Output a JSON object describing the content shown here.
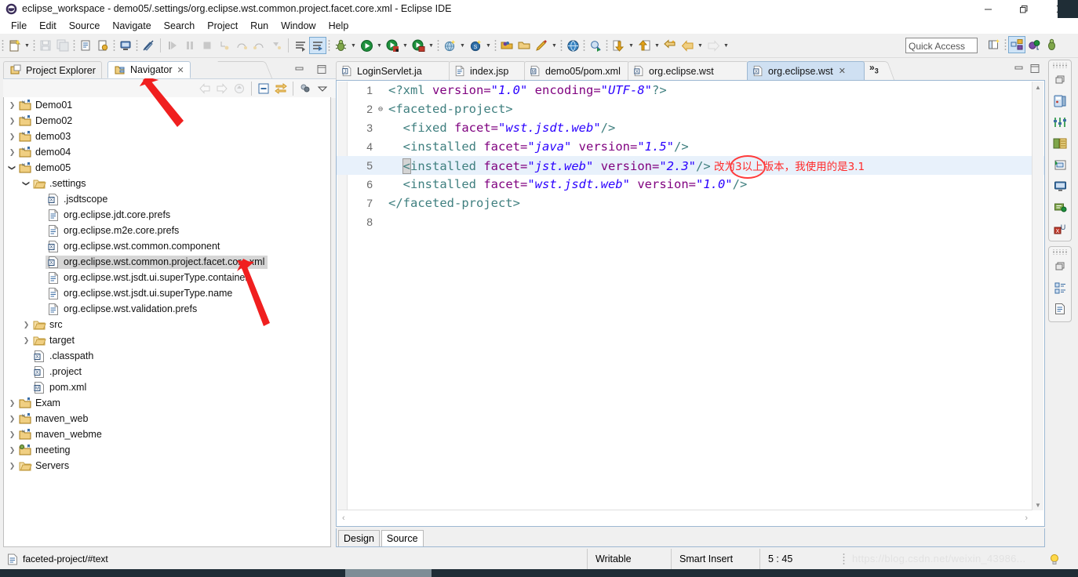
{
  "window": {
    "title": "eclipse_workspace - demo05/.settings/org.eclipse.wst.common.project.facet.core.xml - Eclipse IDE",
    "app_icon": "eclipse-icon",
    "minimize_label": "—",
    "maximize_label": "❐",
    "close_label": "✕"
  },
  "menubar": {
    "items": [
      {
        "label": "File"
      },
      {
        "label": "Edit"
      },
      {
        "label": "Source"
      },
      {
        "label": "Navigate"
      },
      {
        "label": "Search"
      },
      {
        "label": "Project"
      },
      {
        "label": "Run"
      },
      {
        "label": "Window"
      },
      {
        "label": "Help"
      }
    ]
  },
  "toolbar": {
    "quick_access_placeholder": "Quick Access",
    "quick_access_value": "",
    "buttons": [
      {
        "name": "new-wizard-icon",
        "enabled": true,
        "dropdown": true
      },
      {
        "name": "save-icon",
        "enabled": false,
        "dropdown": false
      },
      {
        "name": "save-all-icon",
        "enabled": false,
        "dropdown": false
      },
      {
        "name": "print-icon",
        "enabled": true,
        "dropdown": false
      },
      {
        "name": "export-icon",
        "enabled": true,
        "dropdown": false
      },
      {
        "name": "new-server-icon",
        "enabled": true,
        "dropdown": false
      },
      {
        "name": "no-marker-icon",
        "enabled": true,
        "dropdown": false
      },
      {
        "name": "resume-icon",
        "enabled": false,
        "dropdown": false
      },
      {
        "name": "suspend-icon",
        "enabled": false,
        "dropdown": false
      },
      {
        "name": "terminate-icon",
        "enabled": false,
        "dropdown": false
      },
      {
        "name": "step-into-icon",
        "enabled": false,
        "dropdown": false
      },
      {
        "name": "step-over-icon",
        "enabled": false,
        "dropdown": false
      },
      {
        "name": "step-return-icon",
        "enabled": false,
        "dropdown": false
      },
      {
        "name": "drop-to-frame-icon",
        "enabled": false,
        "dropdown": false
      },
      {
        "name": "skip-breakpoints-icon",
        "enabled": true,
        "dropdown": false
      },
      {
        "name": "toggle-breakpoint-icon",
        "enabled": true,
        "dropdown": false,
        "selected": true
      },
      {
        "name": "debug-icon",
        "enabled": true,
        "dropdown": true
      },
      {
        "name": "run-icon",
        "enabled": true,
        "dropdown": true
      },
      {
        "name": "run-server-icon",
        "enabled": true,
        "dropdown": true
      },
      {
        "name": "stop-server-icon",
        "enabled": true,
        "dropdown": true
      },
      {
        "name": "new-web-project-icon",
        "enabled": true,
        "dropdown": true
      },
      {
        "name": "new-ejb-icon",
        "enabled": true,
        "dropdown": true
      },
      {
        "name": "open-type-icon",
        "enabled": true,
        "dropdown": false
      },
      {
        "name": "open-resource-icon",
        "enabled": true,
        "dropdown": false
      },
      {
        "name": "maven-build-icon",
        "enabled": true,
        "dropdown": true
      },
      {
        "name": "web-browser-icon",
        "enabled": true,
        "dropdown": false
      },
      {
        "name": "search-icon",
        "enabled": true,
        "dropdown": false
      },
      {
        "name": "next-annotation-icon",
        "enabled": true,
        "dropdown": true
      },
      {
        "name": "previous-annotation-icon",
        "enabled": true,
        "dropdown": true
      },
      {
        "name": "last-edit-location-icon",
        "enabled": true,
        "dropdown": false
      },
      {
        "name": "back-icon",
        "enabled": true,
        "dropdown": true
      },
      {
        "name": "forward-icon",
        "enabled": false,
        "dropdown": true
      }
    ],
    "perspective_buttons": [
      {
        "name": "open-perspective-icon",
        "selected": false
      },
      {
        "name": "perspective-java-ee-icon",
        "selected": true
      },
      {
        "name": "perspective-java-icon",
        "selected": false
      },
      {
        "name": "perspective-debug-icon",
        "selected": false
      }
    ]
  },
  "left_view": {
    "tabs": [
      {
        "label": "Project Explorer",
        "icon": "project-explorer-icon",
        "active": false,
        "closable": false
      },
      {
        "label": "Navigator",
        "icon": "navigator-icon",
        "active": true,
        "closable": true
      }
    ],
    "close_glyph": "✕",
    "minimize_glyph": "—",
    "maximize_glyph": "❐",
    "view_toolbar": [
      {
        "name": "back-icon",
        "enabled": false
      },
      {
        "name": "forward-icon",
        "enabled": false
      },
      {
        "name": "up-one-level-icon",
        "enabled": false
      },
      {
        "name": "collapse-all-icon",
        "enabled": true
      },
      {
        "name": "link-with-editor-icon",
        "enabled": true
      },
      {
        "name": "filters-icon",
        "enabled": true
      },
      {
        "name": "view-menu-icon",
        "enabled": true
      }
    ],
    "tree": [
      {
        "label": "Demo01",
        "depth": 0,
        "icon": "maven-project-icon",
        "state": "collapsed",
        "selected": false
      },
      {
        "label": "Demo02",
        "depth": 0,
        "icon": "maven-project-icon",
        "state": "collapsed",
        "selected": false
      },
      {
        "label": "demo03",
        "depth": 0,
        "icon": "maven-project-icon",
        "state": "collapsed",
        "selected": false
      },
      {
        "label": "demo04",
        "depth": 0,
        "icon": "maven-project-icon",
        "state": "collapsed",
        "selected": false
      },
      {
        "label": "demo05",
        "depth": 0,
        "icon": "maven-project-icon",
        "state": "expanded",
        "selected": false
      },
      {
        "label": ".settings",
        "depth": 1,
        "icon": "folder-icon",
        "state": "expanded",
        "selected": false
      },
      {
        "label": ".jsdtscope",
        "depth": 2,
        "icon": "xml-file-icon",
        "state": "leaf",
        "selected": false
      },
      {
        "label": "org.eclipse.jdt.core.prefs",
        "depth": 2,
        "icon": "text-file-icon",
        "state": "leaf",
        "selected": false
      },
      {
        "label": "org.eclipse.m2e.core.prefs",
        "depth": 2,
        "icon": "text-file-icon",
        "state": "leaf",
        "selected": false
      },
      {
        "label": "org.eclipse.wst.common.component",
        "depth": 2,
        "icon": "xml-file-icon",
        "state": "leaf",
        "selected": false
      },
      {
        "label": "org.eclipse.wst.common.project.facet.core.xml",
        "depth": 2,
        "icon": "xml-file-icon",
        "state": "leaf",
        "selected": true
      },
      {
        "label": "org.eclipse.wst.jsdt.ui.superType.container",
        "depth": 2,
        "icon": "text-file-icon",
        "state": "leaf",
        "selected": false
      },
      {
        "label": "org.eclipse.wst.jsdt.ui.superType.name",
        "depth": 2,
        "icon": "text-file-icon",
        "state": "leaf",
        "selected": false
      },
      {
        "label": "org.eclipse.wst.validation.prefs",
        "depth": 2,
        "icon": "text-file-icon",
        "state": "leaf",
        "selected": false
      },
      {
        "label": "src",
        "depth": 1,
        "icon": "folder-icon",
        "state": "collapsed",
        "selected": false
      },
      {
        "label": "target",
        "depth": 1,
        "icon": "folder-icon",
        "state": "collapsed",
        "selected": false
      },
      {
        "label": ".classpath",
        "depth": 1,
        "icon": "xml-file-icon",
        "state": "leaf",
        "selected": false
      },
      {
        "label": ".project",
        "depth": 1,
        "icon": "xml-file-icon",
        "state": "leaf",
        "selected": false
      },
      {
        "label": "pom.xml",
        "depth": 1,
        "icon": "maven-file-icon",
        "state": "leaf",
        "selected": false
      },
      {
        "label": "Exam",
        "depth": 0,
        "icon": "java-project-icon",
        "state": "collapsed",
        "selected": false
      },
      {
        "label": "maven_web",
        "depth": 0,
        "icon": "maven-project-icon",
        "state": "collapsed",
        "selected": false
      },
      {
        "label": "maven_webme",
        "depth": 0,
        "icon": "maven-project-icon",
        "state": "collapsed",
        "selected": false
      },
      {
        "label": "meeting",
        "depth": 0,
        "icon": "web-project-icon",
        "state": "collapsed",
        "selected": false
      },
      {
        "label": "Servers",
        "depth": 0,
        "icon": "folder-project-icon",
        "state": "collapsed",
        "selected": false
      }
    ]
  },
  "editor": {
    "tabs": [
      {
        "label": "LoginServlet.ja",
        "icon": "java-file-icon",
        "active": false,
        "closable": false
      },
      {
        "label": "index.jsp",
        "icon": "jsp-file-icon",
        "active": false,
        "closable": false
      },
      {
        "label": "demo05/pom.xml",
        "icon": "maven-file-icon",
        "active": false,
        "closable": false
      },
      {
        "label": "org.eclipse.wst",
        "icon": "xml-file-icon",
        "active": false,
        "closable": false
      },
      {
        "label": "org.eclipse.wst",
        "icon": "xml-file-icon",
        "active": true,
        "closable": true
      }
    ],
    "overflow_label": "»",
    "overflow_count": "3",
    "close_glyph": "✕",
    "minimize_glyph": "—",
    "maximize_glyph": "❐",
    "lines": [
      {
        "num": "1",
        "fold": "",
        "highlight": false,
        "segments": [
          {
            "text": "<?xml ",
            "cls": "k-pi"
          },
          {
            "text": "version=",
            "cls": "k-attr"
          },
          {
            "text": "\"1.0\"",
            "cls": "k-val"
          },
          {
            "text": " ",
            "cls": "k-plain"
          },
          {
            "text": "encoding=",
            "cls": "k-attr"
          },
          {
            "text": "\"UTF-8\"",
            "cls": "k-val"
          },
          {
            "text": "?>",
            "cls": "k-pi"
          }
        ]
      },
      {
        "num": "2",
        "fold": "⊖",
        "highlight": false,
        "segments": [
          {
            "text": "<faceted-project>",
            "cls": "k-tag"
          }
        ]
      },
      {
        "num": "3",
        "fold": "",
        "highlight": false,
        "segments": [
          {
            "text": "  <fixed ",
            "cls": "k-tag"
          },
          {
            "text": "facet=",
            "cls": "k-attr"
          },
          {
            "text": "\"wst.jsdt.web\"",
            "cls": "k-val"
          },
          {
            "text": "/>",
            "cls": "k-tag"
          }
        ]
      },
      {
        "num": "4",
        "fold": "",
        "highlight": false,
        "segments": [
          {
            "text": "  <installed ",
            "cls": "k-tag"
          },
          {
            "text": "facet=",
            "cls": "k-attr"
          },
          {
            "text": "\"java\"",
            "cls": "k-val"
          },
          {
            "text": " ",
            "cls": "k-plain"
          },
          {
            "text": "version=",
            "cls": "k-attr"
          },
          {
            "text": "\"1.5\"",
            "cls": "k-val"
          },
          {
            "text": "/>",
            "cls": "k-tag"
          }
        ]
      },
      {
        "num": "5",
        "fold": "",
        "highlight": true,
        "segments": [
          {
            "text": "  ",
            "cls": "k-plain"
          },
          {
            "text": "<",
            "cls": "k-tag sel-caret"
          },
          {
            "text": "installed ",
            "cls": "k-tag"
          },
          {
            "text": "facet=",
            "cls": "k-attr"
          },
          {
            "text": "\"jst.web\"",
            "cls": "k-val"
          },
          {
            "text": " ",
            "cls": "k-plain"
          },
          {
            "text": "version=",
            "cls": "k-attr"
          },
          {
            "text": "\"2.3\"",
            "cls": "k-val"
          },
          {
            "text": "/>",
            "cls": "k-tag"
          }
        ],
        "annotation": "改为3以上版本，我使用的是3.1"
      },
      {
        "num": "6",
        "fold": "",
        "highlight": false,
        "segments": [
          {
            "text": "  <installed ",
            "cls": "k-tag"
          },
          {
            "text": "facet=",
            "cls": "k-attr"
          },
          {
            "text": "\"wst.jsdt.web\"",
            "cls": "k-val"
          },
          {
            "text": " ",
            "cls": "k-plain"
          },
          {
            "text": "version=",
            "cls": "k-attr"
          },
          {
            "text": "\"1.0\"",
            "cls": "k-val"
          },
          {
            "text": "/>",
            "cls": "k-tag"
          }
        ]
      },
      {
        "num": "7",
        "fold": "",
        "highlight": false,
        "segments": [
          {
            "text": "</faceted-project>",
            "cls": "k-tag"
          }
        ]
      },
      {
        "num": "8",
        "fold": "",
        "highlight": false,
        "segments": []
      }
    ],
    "bottom_tabs": [
      {
        "label": "Design",
        "active": false
      },
      {
        "label": "Source",
        "active": true
      }
    ],
    "scroll_left_glyph": "‹",
    "scroll_right_glyph": "›",
    "scroll_up_glyph": "▲",
    "scroll_down_glyph": "▼"
  },
  "fastview": {
    "groups": [
      {
        "items": [
          {
            "name": "restore-icon"
          },
          {
            "name": "servers-view-icon"
          },
          {
            "name": "properties-view-icon"
          },
          {
            "name": "data-source-explorer-icon"
          },
          {
            "name": "snippets-view-icon"
          },
          {
            "name": "console-view-icon"
          },
          {
            "name": "markers-view-icon"
          },
          {
            "name": "validation-view-icon"
          }
        ]
      },
      {
        "items": [
          {
            "name": "restore-icon"
          },
          {
            "name": "outline-view-icon"
          },
          {
            "name": "task-list-icon"
          }
        ]
      }
    ]
  },
  "statusbar": {
    "selection_path": "faceted-project/#text",
    "selection_icon": "text-file-icon",
    "cells": [
      {
        "label": "Writable"
      },
      {
        "label": "Smart Insert"
      },
      {
        "label": "5 : 45"
      }
    ],
    "watermark": "https://blog.csdn.net/weixin_43986...",
    "tip_icon": "lightbulb-icon"
  },
  "colors": {
    "accent_blue": "#cfe0f2",
    "tab_border": "#9db8d2",
    "selection_grey": "#d6d6d6",
    "highlight_line": "#e8f1fb",
    "annotation_red": "#ff2b2b",
    "xml_tag": "#3f7f7f",
    "xml_attr": "#7f007f",
    "xml_value": "#2a00ff",
    "chrome_bg": "#f0f0f0"
  }
}
